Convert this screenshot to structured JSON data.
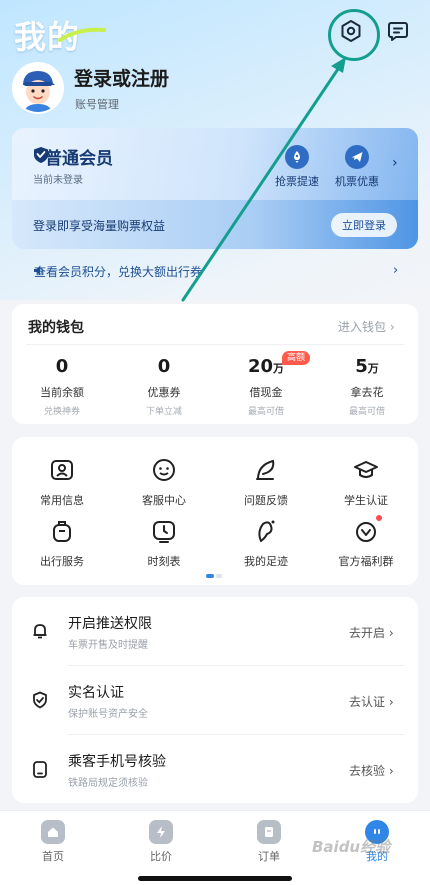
{
  "header": {
    "title": "我的",
    "icons": [
      "settings-icon",
      "message-icon"
    ]
  },
  "profile": {
    "login_title": "登录或注册",
    "account_mgmt": "账号管理"
  },
  "member": {
    "title": "普通会员",
    "subtitle": "当前未登录",
    "perks": [
      {
        "label": "抢票提速",
        "icon": "rocket-icon"
      },
      {
        "label": "机票优惠",
        "icon": "plane-icon"
      }
    ],
    "promo": "登录即享受海量购票权益",
    "login_button": "立即登录"
  },
  "points_bar": {
    "text": "查看会员积分，兑换大额出行券"
  },
  "wallet": {
    "title": "我的钱包",
    "link": "进入钱包",
    "badge": "高额",
    "stats": [
      {
        "value": "0",
        "unit": "",
        "label": "当前余额",
        "sub": "兑换神券"
      },
      {
        "value": "0",
        "unit": "",
        "label": "优惠券",
        "sub": "下单立减"
      },
      {
        "value": "20",
        "unit": "万",
        "label": "借现金",
        "sub": "最高可借"
      },
      {
        "value": "5",
        "unit": "万",
        "label": "拿去花",
        "sub": "最高可借"
      }
    ]
  },
  "services": {
    "items": [
      {
        "label": "常用信息",
        "icon": "id-card-icon"
      },
      {
        "label": "客服中心",
        "icon": "customer-service-icon"
      },
      {
        "label": "问题反馈",
        "icon": "feedback-icon"
      },
      {
        "label": "学生认证",
        "icon": "graduation-cap-icon"
      },
      {
        "label": "出行服务",
        "icon": "luggage-icon"
      },
      {
        "label": "时刻表",
        "icon": "schedule-icon"
      },
      {
        "label": "我的足迹",
        "icon": "footprint-icon"
      },
      {
        "label": "官方福利群",
        "icon": "gift-group-icon"
      }
    ]
  },
  "settings_list": {
    "rows": [
      {
        "title": "开启推送权限",
        "sub": "车票开售及时提醒",
        "action": "去开启",
        "icon": "bell-icon"
      },
      {
        "title": "实名认证",
        "sub": "保护账号资产安全",
        "action": "去认证",
        "icon": "shield-check-icon"
      },
      {
        "title": "乘客手机号核验",
        "sub": "铁路局规定须核验",
        "action": "去核验",
        "icon": "phone-icon"
      }
    ]
  },
  "tabbar": {
    "tabs": [
      {
        "label": "首页",
        "icon": "home-icon",
        "active": false
      },
      {
        "label": "比价",
        "icon": "lightning-icon",
        "active": false
      },
      {
        "label": "订单",
        "icon": "order-icon",
        "active": false
      },
      {
        "label": "我的",
        "icon": "profile-face-icon",
        "active": true
      }
    ]
  },
  "watermark": "Baidu经验",
  "colors": {
    "accent": "#2f86e6",
    "annotation": "#149e8f",
    "badge": "#ff5b4d"
  }
}
